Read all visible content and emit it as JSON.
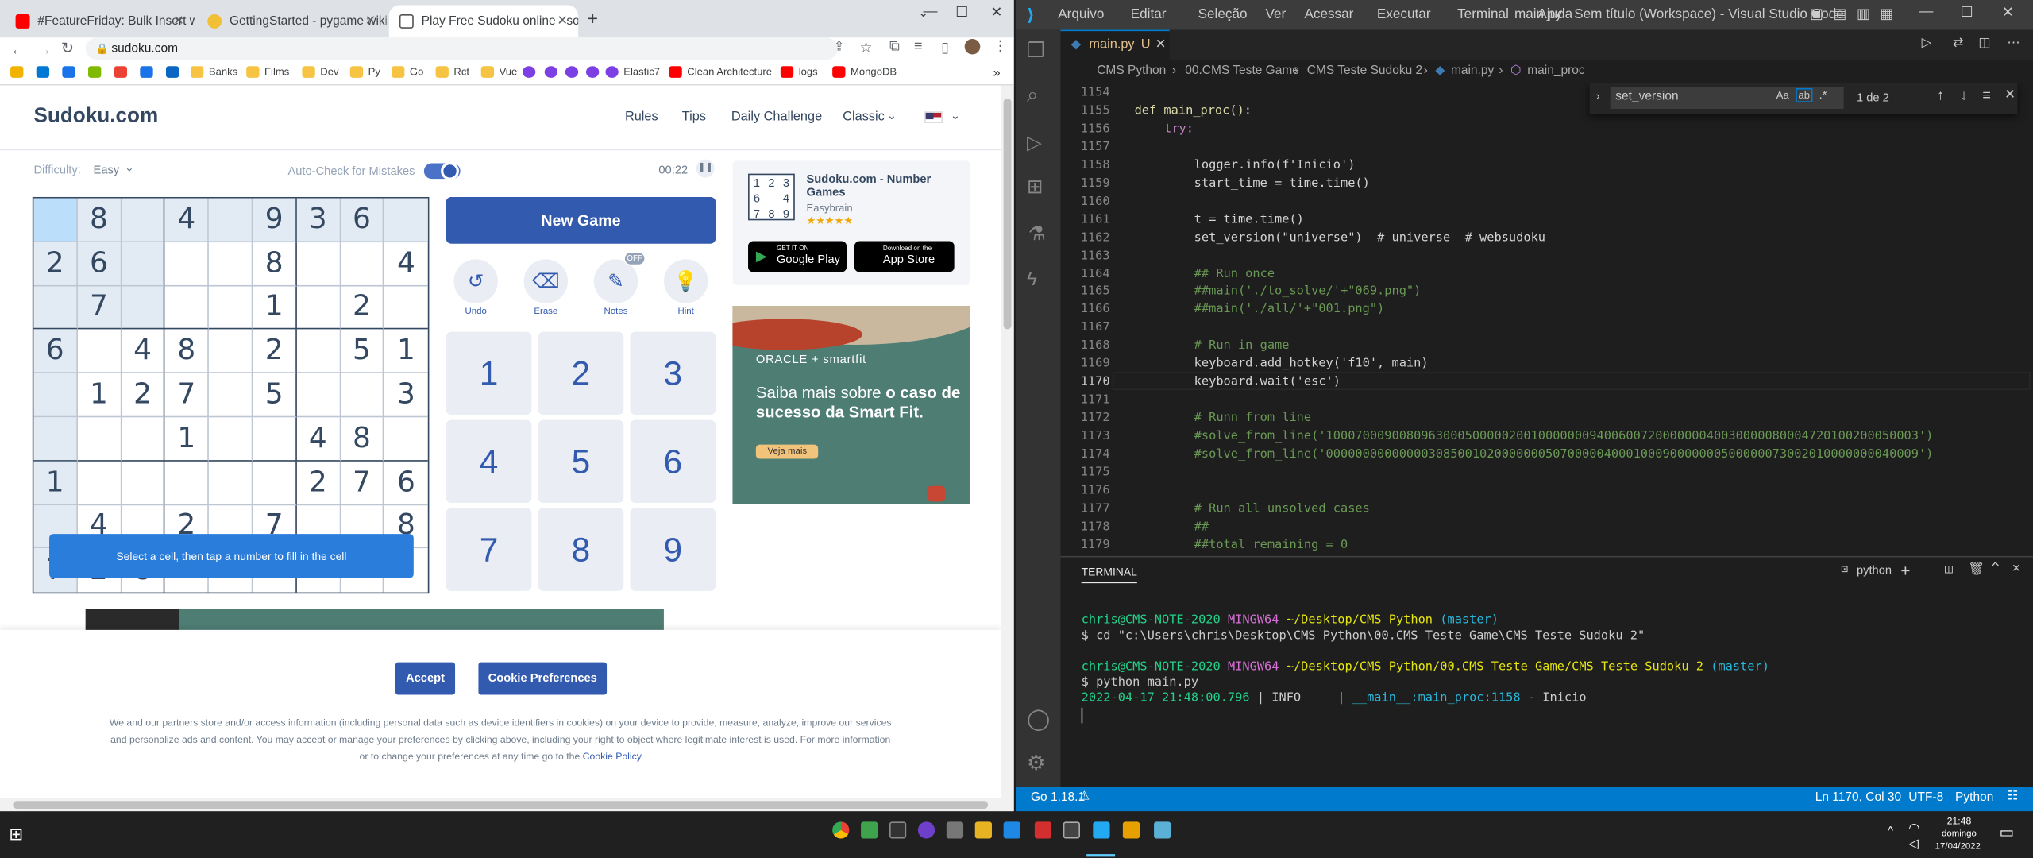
{
  "browser": {
    "tabs": [
      {
        "title": "#FeatureFriday: Bulk Insert with N",
        "icon": "youtube-icon"
      },
      {
        "title": "GettingStarted - pygame wiki",
        "icon": "pygame-icon"
      },
      {
        "title": "Play Free Sudoku online - solve",
        "icon": "sudoku-icon"
      }
    ],
    "url": "sudoku.com",
    "bookmarks": [
      "Banks",
      "Films",
      "Dev",
      "Py",
      "Go",
      "Rct",
      "Vue",
      "Elastic7",
      "Clean Architecture",
      "logs",
      "MongoDB"
    ]
  },
  "sudoku": {
    "logo": "Sudoku.com",
    "nav": [
      "Rules",
      "Tips",
      "Daily Challenge",
      "Classic"
    ],
    "difficulty_label": "Difficulty:",
    "difficulty_value": "Easy",
    "auto_check_label": "Auto-Check for Mistakes",
    "timer": "00:22",
    "grid": [
      [
        "",
        "8",
        "",
        "4",
        "",
        "9",
        "3",
        "6",
        ""
      ],
      [
        "2",
        "6",
        "",
        "",
        "",
        "8",
        "",
        "",
        "4"
      ],
      [
        "",
        "7",
        "",
        "",
        "",
        "1",
        "",
        "2",
        ""
      ],
      [
        "6",
        "",
        "4",
        "8",
        "",
        "2",
        "",
        "5",
        "1"
      ],
      [
        "",
        "1",
        "2",
        "7",
        "",
        "5",
        "",
        "",
        "3"
      ],
      [
        "",
        "",
        "",
        "1",
        "",
        "",
        "4",
        "8",
        ""
      ],
      [
        "1",
        "",
        "",
        "",
        "",
        "",
        "2",
        "7",
        "6"
      ],
      [
        "",
        "4",
        "",
        "2",
        "",
        "7",
        "",
        "",
        "8"
      ],
      [
        "7",
        "2",
        "8",
        "",
        "",
        "",
        "",
        "",
        ""
      ]
    ],
    "tooltip": "Select a cell, then tap a number to fill in the cell",
    "new_game": "New Game",
    "tools": [
      {
        "label": "Undo",
        "icon": "undo-icon"
      },
      {
        "label": "Erase",
        "icon": "eraser-icon"
      },
      {
        "label": "Notes",
        "icon": "pencil-icon",
        "badge": "OFF"
      },
      {
        "label": "Hint",
        "icon": "lightbulb-icon"
      }
    ],
    "numbers": [
      "1",
      "2",
      "3",
      "4",
      "5",
      "6",
      "7",
      "8",
      "9"
    ],
    "app_promo": {
      "title": "Sudoku.com - Number Games",
      "publisher": "Easybrain",
      "rating": 4.5,
      "google": "Google Play",
      "google_small": "GET IT ON",
      "apple": "App Store",
      "apple_small": "Download on the"
    },
    "ad": {
      "brand": "ORACLE + smartfit",
      "text_plain": "Saiba mais sobre ",
      "text_bold": "o caso de sucesso da Smart Fit.",
      "cta": "Veja mais"
    },
    "cookie": {
      "accept": "Accept",
      "prefs": "Cookie Preferences",
      "text": "We and our partners store and/or access information (including personal data such as device identifiers in cookies) on your device to provide, measure, analyze, improve our services and personalize ads and content. You may accept or manage your preferences by clicking above, including your right to object where legitimate interest is used. For more information or to change your preferences at any time go to the ",
      "link": "Cookie Policy"
    }
  },
  "vscode": {
    "menu": [
      "Arquivo",
      "Editar",
      "Seleção",
      "Ver",
      "Acessar",
      "Executar",
      "Terminal",
      "Ajuda"
    ],
    "title": "main.py - Sem título (Workspace) - Visual Studio Code",
    "tab": "main.py",
    "tab_flag": "U",
    "breadcrumb": [
      "CMS Python",
      "00.CMS Teste Game",
      "CMS Teste Sudoku 2",
      "main.py",
      "main_proc"
    ],
    "find": {
      "query": "set_version",
      "count": "1 de 2"
    },
    "line_numbers": [
      "1154",
      "1155",
      "1156",
      "1157",
      "1158",
      "1159",
      "1160",
      "1161",
      "1162",
      "1163",
      "1164",
      "1165",
      "1166",
      "1167",
      "1168",
      "1169",
      "1170",
      "1171",
      "1172",
      "1173",
      "1174",
      "1175",
      "1176",
      "1177",
      "1178",
      "1179"
    ],
    "code": {
      "l1155": "def main_proc():",
      "l1156": "try:",
      "l1158": "logger.info(f'Inicio')",
      "l1159": "start_time = time.time()",
      "l1161": "t = time.time()",
      "l1162": "set_version(\"universe\")  # universe  # websudoku",
      "l1164": "## Run once",
      "l1165": "##main('./to_solve/'+\"069.png\")",
      "l1166": "##main('./all/'+\"001.png\")",
      "l1168": "# Run in game",
      "l1169": "keyboard.add_hotkey('f10', main)",
      "l1170": "keyboard.wait('esc')",
      "l1172": "# Runn from line",
      "l1173": "#solve_from_line('100070009008096300050000020010000000940060072000000040030000080004720100200050003')",
      "l1174": "#solve_from_line('000000000000003085001020000000507000004000100090000000500000073002010000000040009')",
      "l1177": "# Run all unsolved cases",
      "l1178": "##",
      "l1179": "##total_remaining = 0"
    },
    "panel_title": "TERMINAL",
    "shell": "python",
    "terminal": {
      "user": "chris@CMS-NOTE-2020",
      "env": "MINGW64",
      "path1": "~/Desktop/CMS Python",
      "branch1": "(master)",
      "cmd1": "$ cd \"c:\\Users\\chris\\Desktop\\CMS Python\\00.CMS Teste Game\\CMS Teste Sudoku 2\"",
      "path2": "~/Desktop/CMS Python/00.CMS Teste Game/CMS Teste Sudoku 2",
      "branch2": "(master)",
      "cmd2": "$ python main.py",
      "log_time": "2022-04-17 21:48:00.796",
      "log_level": "| INFO     |",
      "log_src": "__main__:main_proc:1158",
      "log_msg": "- Inicio"
    },
    "status": {
      "go": "Go 1.18.1",
      "position": "Ln 1170, Col 30",
      "encoding": "UTF-8",
      "language": "Python"
    }
  },
  "taskbar": {
    "time": "21:48",
    "day": "domingo",
    "date": "17/04/2022"
  }
}
